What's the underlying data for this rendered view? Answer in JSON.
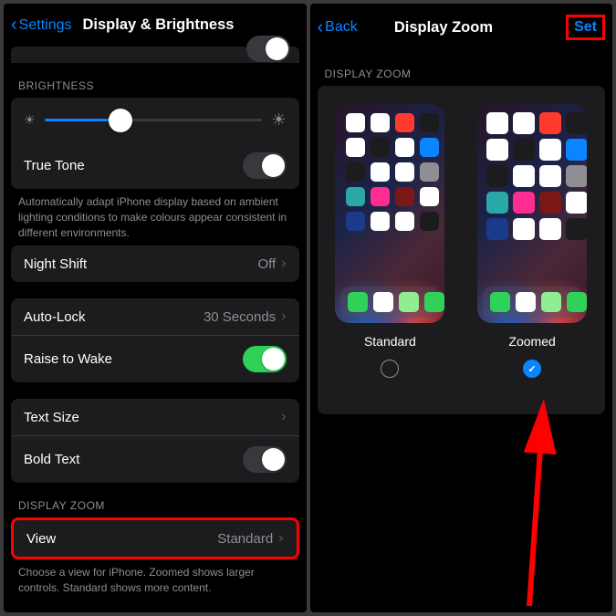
{
  "left": {
    "back_label": "Settings",
    "title": "Display & Brightness",
    "sections": {
      "brightness": {
        "header": "BRIGHTNESS",
        "true_tone": "True Tone",
        "true_tone_footer": "Automatically adapt iPhone display based on ambient lighting conditions to make colours appear consistent in different environments."
      },
      "night_shift": {
        "label": "Night Shift",
        "value": "Off"
      },
      "auto_lock": {
        "label": "Auto-Lock",
        "value": "30 Seconds"
      },
      "raise_to_wake": "Raise to Wake",
      "text_size": "Text Size",
      "bold_text": "Bold Text",
      "display_zoom": {
        "header": "DISPLAY ZOOM",
        "view_label": "View",
        "view_value": "Standard",
        "footer": "Choose a view for iPhone. Zoomed shows larger controls. Standard shows more content."
      }
    }
  },
  "right": {
    "back_label": "Back",
    "title": "Display Zoom",
    "action": "Set",
    "section_header": "DISPLAY ZOOM",
    "options": {
      "standard": "Standard",
      "zoomed": "Zoomed"
    }
  }
}
